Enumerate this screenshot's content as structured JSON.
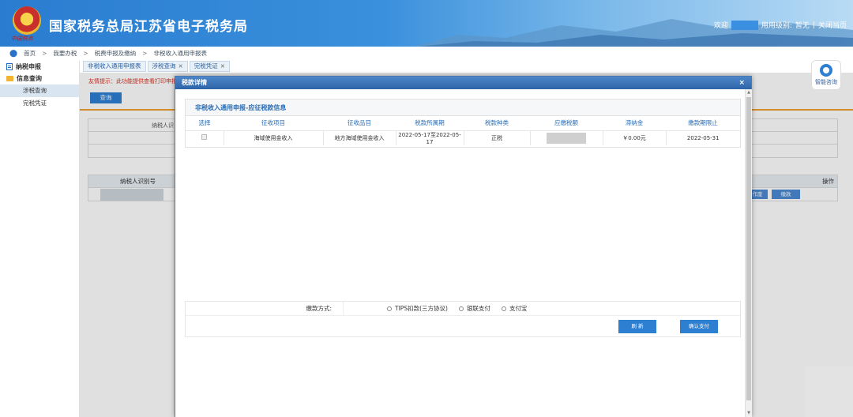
{
  "header": {
    "site_title": "国家税务总局江苏省电子税务局",
    "emblem_text": "中国税务",
    "welcome": "欢迎",
    "role_label": "用用级别:",
    "role_value": "暂无",
    "separator": "|",
    "close_page": "关闭当页"
  },
  "breadcrumb": {
    "items": [
      "首页",
      "我要办税",
      "税费申报及缴纳",
      "非税收入通用申报表"
    ],
    "separator": ">"
  },
  "sidebar": {
    "groups": [
      {
        "label": "纳税申报",
        "icon": "document-icon"
      },
      {
        "label": "信息查询",
        "icon": "folder-icon"
      }
    ],
    "items": [
      {
        "label": "涉税查询",
        "active": true
      },
      {
        "label": "完税凭证",
        "active": false
      }
    ]
  },
  "tabs": [
    {
      "label": "非税收入通用申报表",
      "closable": false
    },
    {
      "label": "涉税查询",
      "closable": true
    },
    {
      "label": "完税凭证",
      "closable": true
    }
  ],
  "tab_close": "×",
  "background": {
    "tip": "友情提示：此功能提供查看打印申报",
    "query_button": "查询",
    "table_label": "纳税人识",
    "grid_header_left": "纳税人识别号",
    "grid_header_right": "操作",
    "btn_1": "作废",
    "btn_2": "缴款"
  },
  "help": {
    "label": "智能咨询"
  },
  "modal": {
    "title": "税款详情",
    "close": "×",
    "section_title": "非税收入通用申报-应征税款信息",
    "columns": [
      "选择",
      "征收项目",
      "征收品目",
      "税款所属期",
      "税款种类",
      "应缴税额",
      "滞纳金",
      "缴款期限止"
    ],
    "rows": [
      {
        "project": "海域使用金收入",
        "item": "地方海域使用金收入",
        "period": "2022-05-17至2022-05-17",
        "kind": "正税",
        "amount": "",
        "late_fee": "￥0.00元",
        "deadline": "2022-05-31"
      }
    ],
    "payment": {
      "label": "缴款方式:",
      "options": [
        "TIPS扣款(三方协议)",
        "银联支付",
        "支付宝"
      ]
    },
    "refresh_button": "刷 新",
    "confirm_button": "确认支付"
  }
}
